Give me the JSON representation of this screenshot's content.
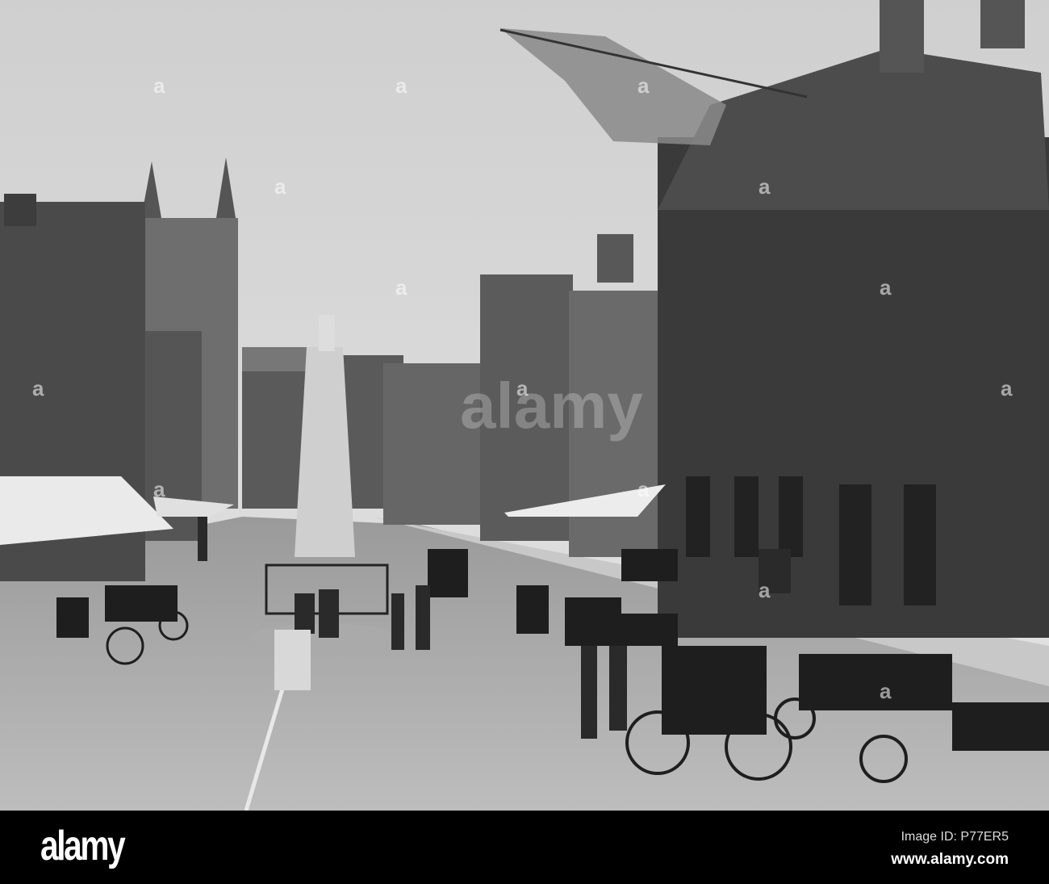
{
  "photo": {
    "subject": "Victorian town square street scene",
    "watermark": "alamy"
  },
  "footer": {
    "logo": "alamy",
    "image_id": "Image ID: P77ER5",
    "website": "www.alamy.com"
  }
}
